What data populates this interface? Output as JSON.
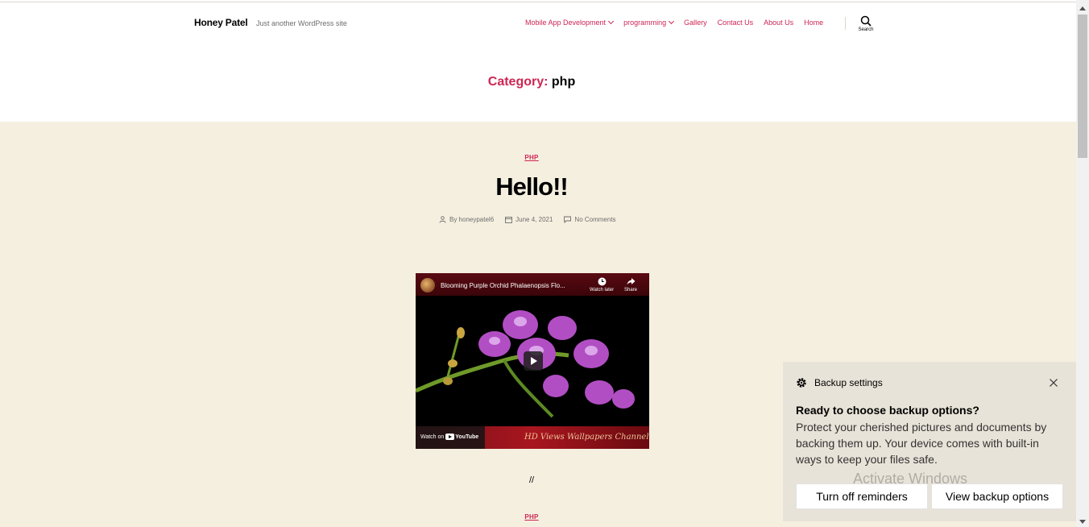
{
  "site": {
    "title": "Honey Patel",
    "description": "Just another WordPress site"
  },
  "nav": {
    "items": [
      {
        "label": "Mobile App Development",
        "has_submenu": true
      },
      {
        "label": "programming",
        "has_submenu": true
      },
      {
        "label": "Gallery",
        "has_submenu": false
      },
      {
        "label": "Contact Us",
        "has_submenu": false
      },
      {
        "label": "About Us",
        "has_submenu": false
      },
      {
        "label": "Home",
        "has_submenu": false
      }
    ],
    "search_label": "Search"
  },
  "archive": {
    "prefix": "Category:",
    "term": "php"
  },
  "post": {
    "category": "PHP",
    "title": "Hello!!",
    "author": "By honeypatel6",
    "date": "June 4, 2021",
    "comments": "No Comments",
    "separator": "//",
    "next_category": "PHP"
  },
  "video": {
    "title": "Blooming Purple Orchid Phalaenopsis Flo...",
    "watch_later": "Watch later",
    "share": "Share",
    "watch_on": "Watch on",
    "youtube": "YouTube",
    "channel_script": "HD Views Wallpapers Channel"
  },
  "toast": {
    "app_name": "Backup settings",
    "heading": "Ready to choose backup options?",
    "body": "Protect your cherished pictures and documents by backing them up. Your device comes with built-in ways to keep your files safe.",
    "watermark_line1": "Activate Windows",
    "btn_turn_off": "Turn off reminders",
    "btn_view": "View backup options"
  },
  "colors": {
    "accent": "#cd2653",
    "content_bg": "#f5efe0",
    "header_bg": "#ffffff",
    "toast_bg": "#e7e2d8"
  }
}
